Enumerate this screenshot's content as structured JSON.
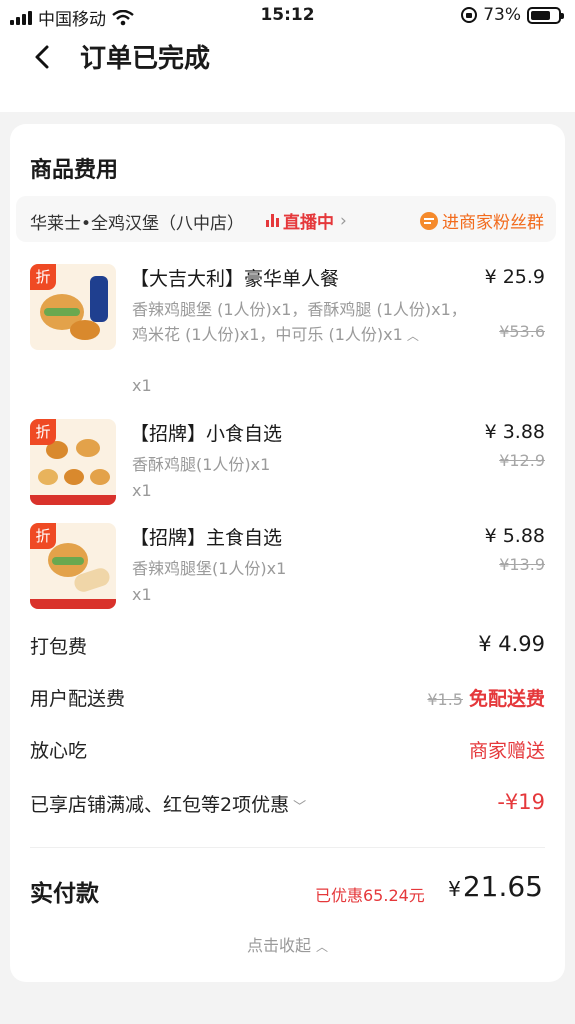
{
  "status_bar": {
    "carrier": "中国移动",
    "time": "15:12",
    "battery": "73%",
    "battery_level": 0.73,
    "icons": [
      "signal-icon",
      "wifi-icon",
      "orientation-lock-icon",
      "battery-icon"
    ]
  },
  "nav": {
    "title": "订单已完成",
    "back_icon": "chevron-left-icon"
  },
  "card": {
    "title": "商品费用",
    "store": {
      "name": "华莱士•全鸡汉堡（八中店）",
      "live_label": "直播中",
      "fan_group_label": "进商家粉丝群"
    },
    "items": [
      {
        "badge": "折",
        "name": "【大吉大利】豪华单人餐",
        "desc": "香辣鸡腿堡 (1人份)x1，香酥鸡腿 (1人份)x1，鸡米花 (1人份)x1，中可乐 (1人份)x1",
        "qty": "x1",
        "price": "¥ 25.9",
        "original_price": "¥53.6"
      },
      {
        "badge": "折",
        "name": "【招牌】小食自选",
        "desc": "香酥鸡腿(1人份)x1",
        "qty": "x1",
        "price": "¥ 3.88",
        "original_price": "¥12.9"
      },
      {
        "badge": "折",
        "name": "【招牌】主食自选",
        "desc": "香辣鸡腿堡(1人份)x1",
        "qty": "x1",
        "price": "¥ 5.88",
        "original_price": "¥13.9"
      }
    ],
    "fees": {
      "packing_label": "打包费",
      "packing_value": "¥ 4.99",
      "delivery_label": "用户配送费",
      "delivery_original": "¥1.5",
      "delivery_value": "免配送费",
      "safe_label": "放心吃",
      "safe_value": "商家赠送",
      "discount_label": "已享店铺满减、红包等2项优惠",
      "discount_value": "-¥19"
    },
    "total": {
      "label": "实付款",
      "saved": "已优惠65.24元",
      "currency": "¥",
      "amount": "21.65"
    },
    "collapse_label": "点击收起"
  },
  "colors": {
    "accent_red": "#e5383b",
    "orange": "#f26b1d",
    "badge": "#ef4a24"
  }
}
